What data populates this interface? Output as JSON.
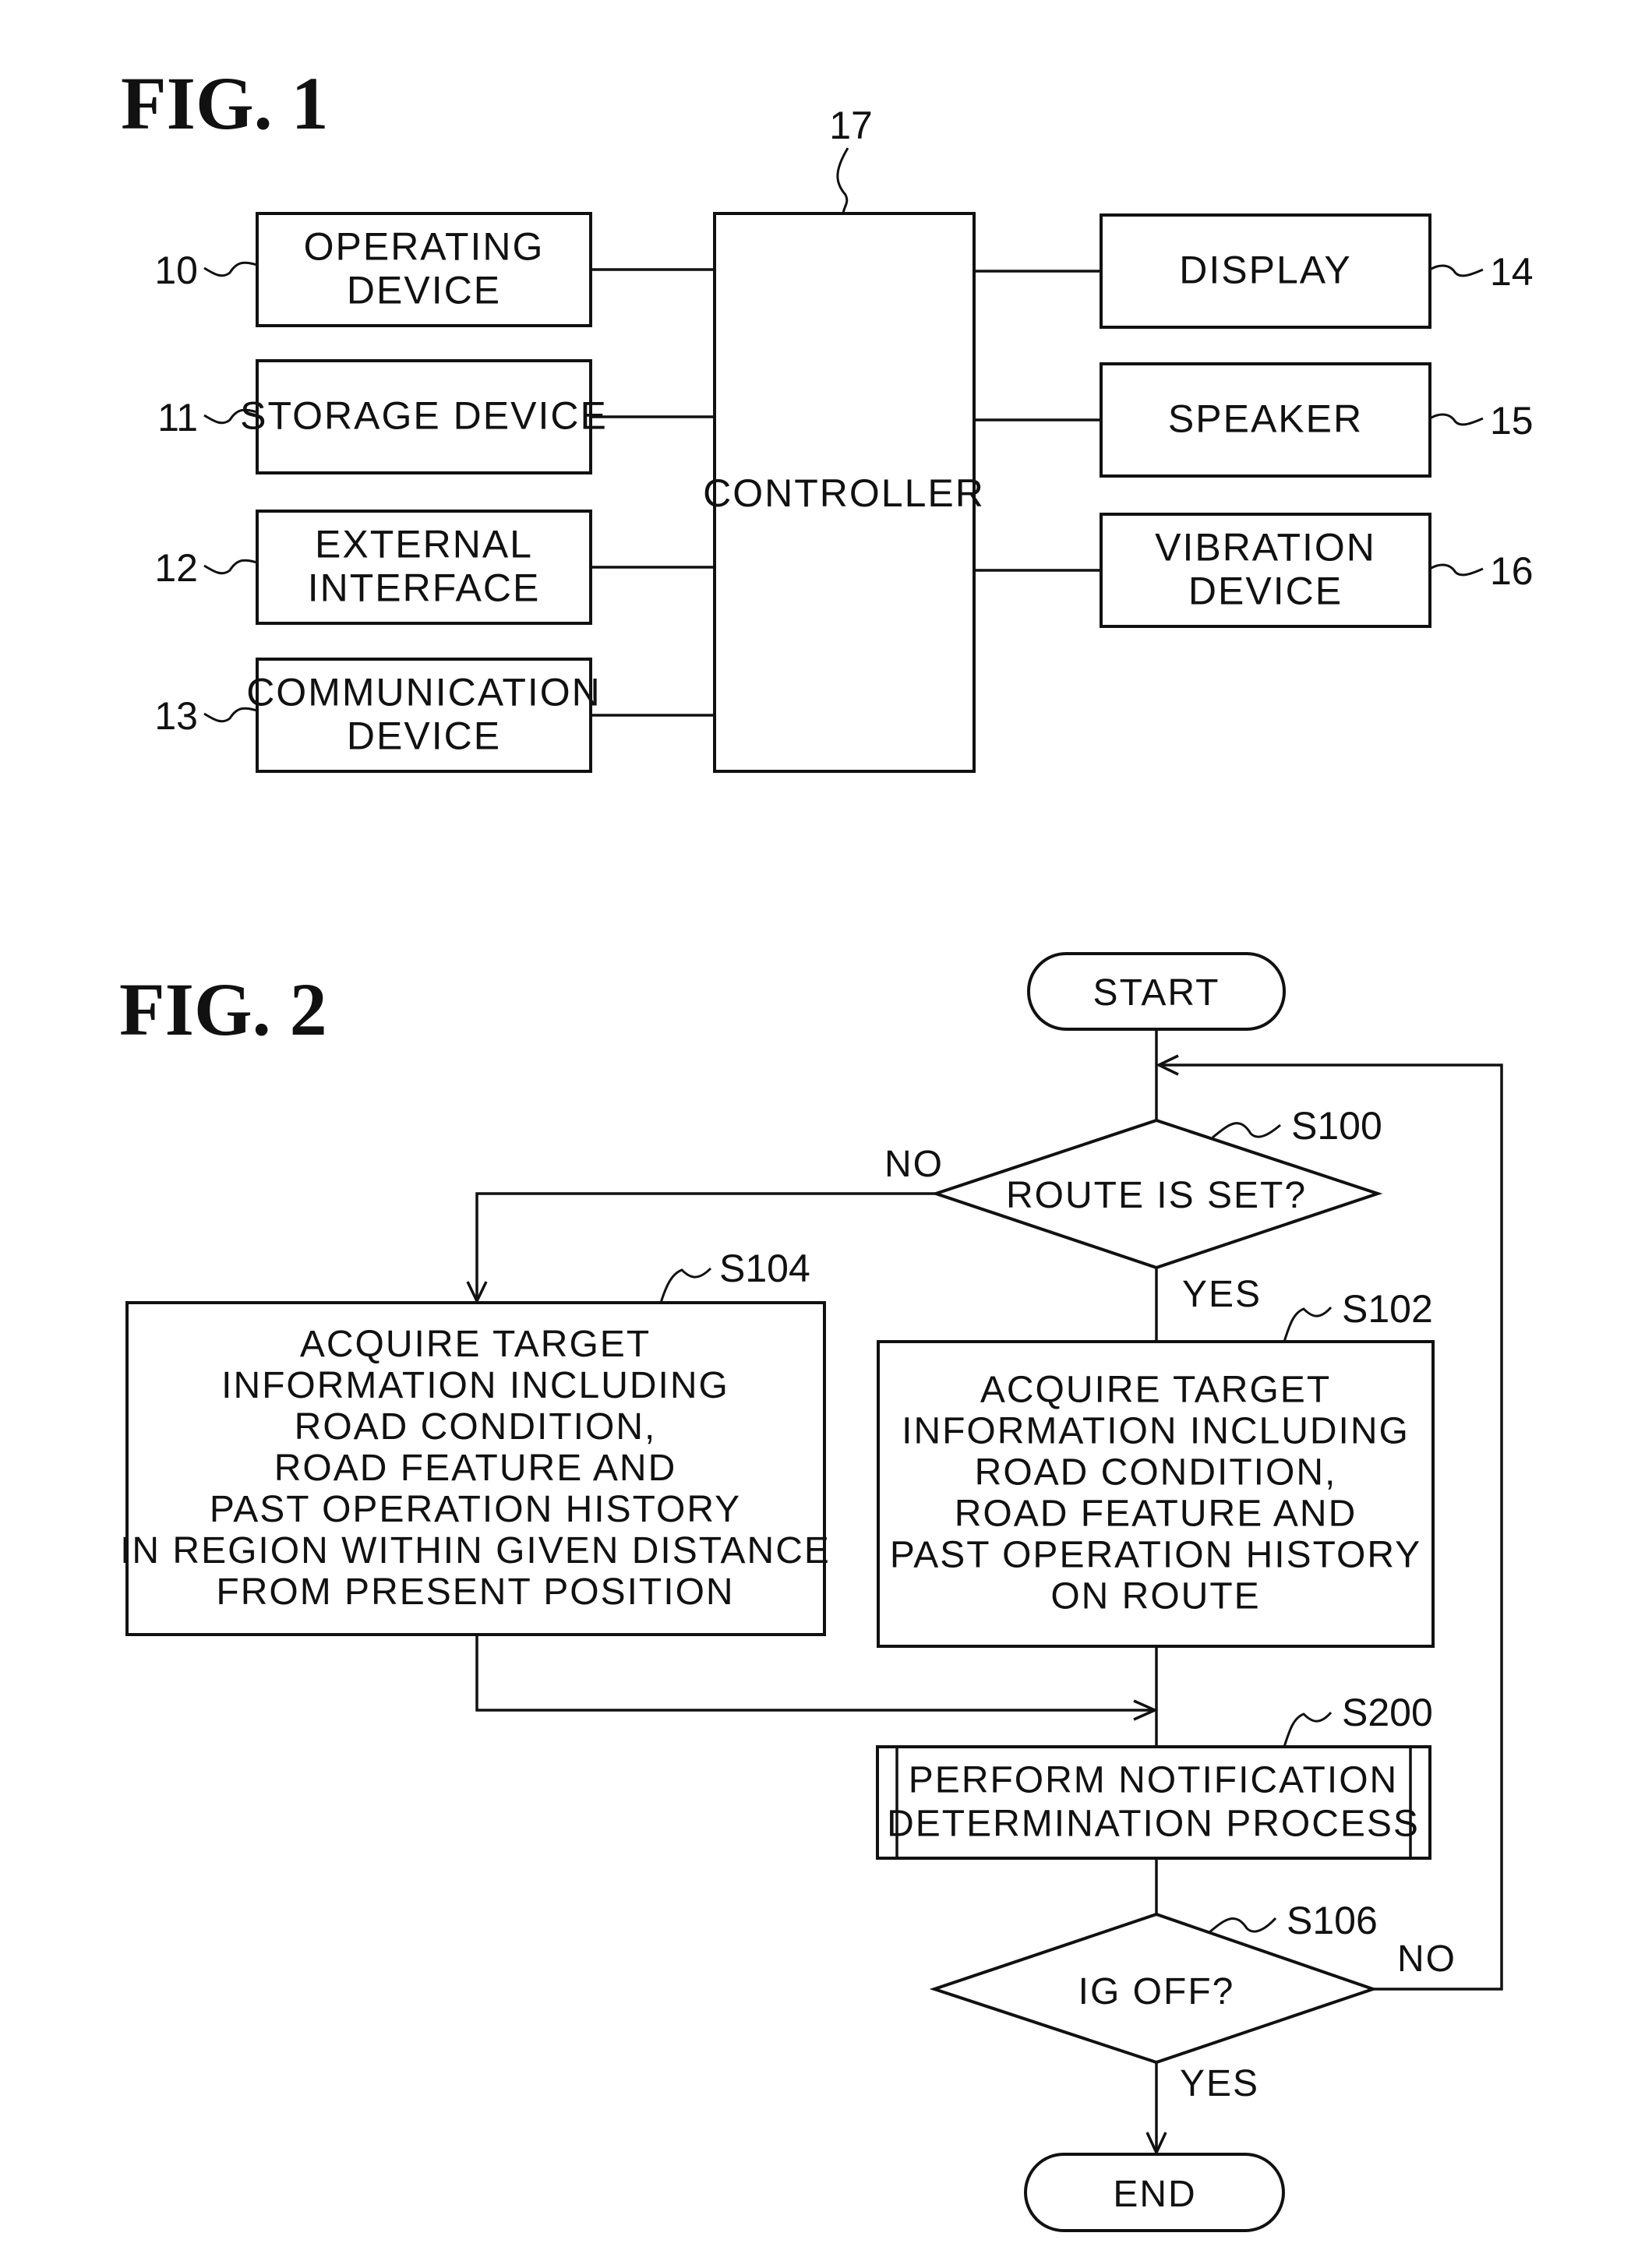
{
  "fig1": {
    "title": "FIG. 1",
    "controller": {
      "ref": "17",
      "label": "CONTROLLER"
    },
    "inputs": [
      {
        "ref": "10",
        "lines": [
          "OPERATING",
          "DEVICE"
        ]
      },
      {
        "ref": "11",
        "lines": [
          "STORAGE DEVICE"
        ]
      },
      {
        "ref": "12",
        "lines": [
          "EXTERNAL",
          "INTERFACE"
        ]
      },
      {
        "ref": "13",
        "lines": [
          "COMMUNICATION",
          "DEVICE"
        ]
      }
    ],
    "outputs": [
      {
        "ref": "14",
        "lines": [
          "DISPLAY"
        ]
      },
      {
        "ref": "15",
        "lines": [
          "SPEAKER"
        ]
      },
      {
        "ref": "16",
        "lines": [
          "VIBRATION",
          "DEVICE"
        ]
      }
    ]
  },
  "fig2": {
    "title": "FIG. 2",
    "start": "START",
    "end": "END",
    "s100": {
      "step": "S100",
      "question": "ROUTE IS SET?",
      "no": "NO",
      "yes": "YES"
    },
    "s102": {
      "step": "S102",
      "lines": [
        "ACQUIRE TARGET",
        "INFORMATION INCLUDING",
        "ROAD CONDITION,",
        "ROAD FEATURE AND",
        "PAST OPERATION HISTORY",
        "ON ROUTE"
      ]
    },
    "s104": {
      "step": "S104",
      "lines": [
        "ACQUIRE TARGET",
        "INFORMATION INCLUDING",
        "ROAD CONDITION,",
        "ROAD FEATURE AND",
        "PAST OPERATION HISTORY",
        "IN REGION WITHIN GIVEN DISTANCE",
        "FROM PRESENT POSITION"
      ]
    },
    "s200": {
      "step": "S200",
      "lines": [
        "PERFORM NOTIFICATION",
        "DETERMINATION PROCESS"
      ]
    },
    "s106": {
      "step": "S106",
      "question": "IG OFF?",
      "no": "NO",
      "yes": "YES"
    }
  }
}
